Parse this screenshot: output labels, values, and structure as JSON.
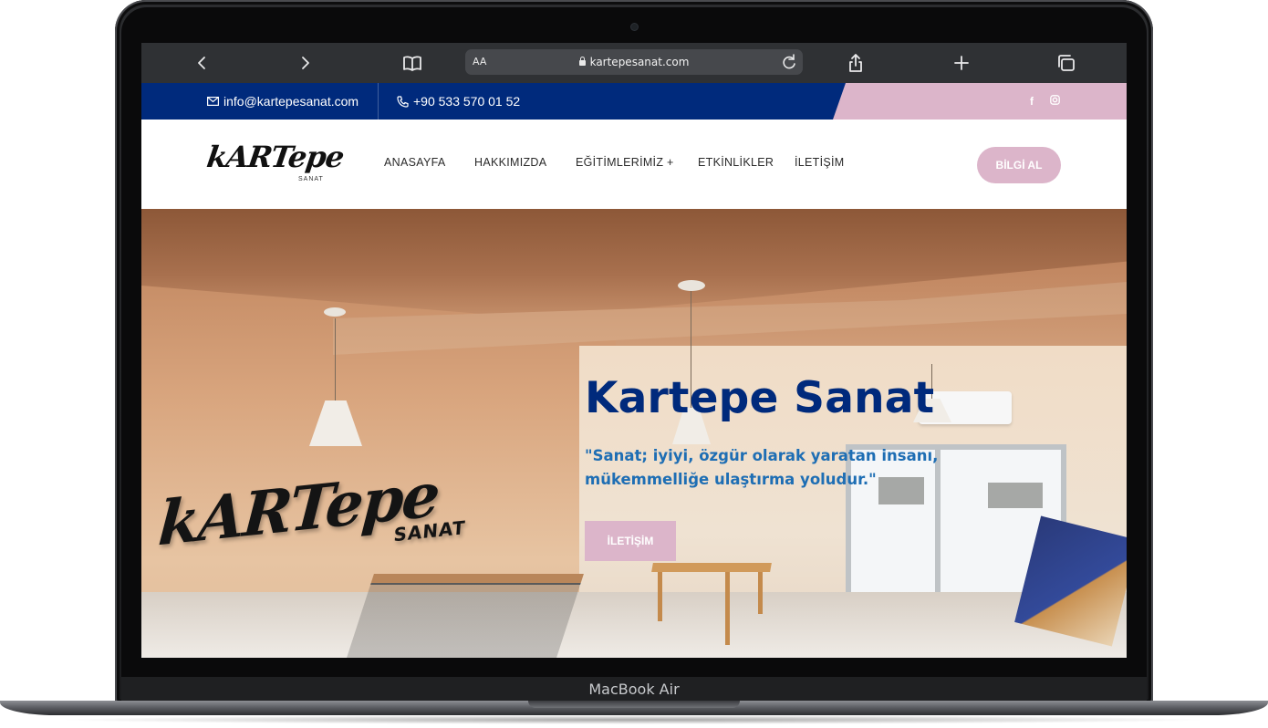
{
  "device": {
    "label": "MacBook Air"
  },
  "browser": {
    "text_size_label": "AA",
    "url": "kartepesanat.com",
    "icons": [
      "back-icon",
      "forward-icon",
      "bookmarks-icon",
      "lock-icon",
      "reload-icon",
      "share-icon",
      "new-tab-icon",
      "tabs-icon"
    ]
  },
  "topbar": {
    "email": "info@kartepesanat.com",
    "phone": "+90 533 570 01 52",
    "social": [
      "facebook-icon",
      "instagram-icon"
    ],
    "colors": {
      "primary": "#002a7c",
      "accent": "#dcb5ca"
    }
  },
  "nav": {
    "logo_text": "kARTepe",
    "logo_sub": "SANAT",
    "items": [
      {
        "label": "ANASAYFA"
      },
      {
        "label": "HAKKIMIZDA"
      },
      {
        "label": "EĞİTİMLERİMİZ +"
      },
      {
        "label": "ETKİNLİKLER"
      },
      {
        "label": "İLETİŞİM"
      }
    ],
    "cta_label": "BİLGİ AL"
  },
  "hero": {
    "title": "Kartepe Sanat",
    "quote": "\"Sanat; iyiyi, özgür olarak yaratan insanı, mükemmelliğe ulaştırma yoludur.\"",
    "button_label": "İLETİŞİM",
    "wall_logo_text": "kARTepe",
    "wall_logo_sub": "SANAT",
    "colors": {
      "title": "#002a7c",
      "quote": "#1e6eb4"
    }
  }
}
